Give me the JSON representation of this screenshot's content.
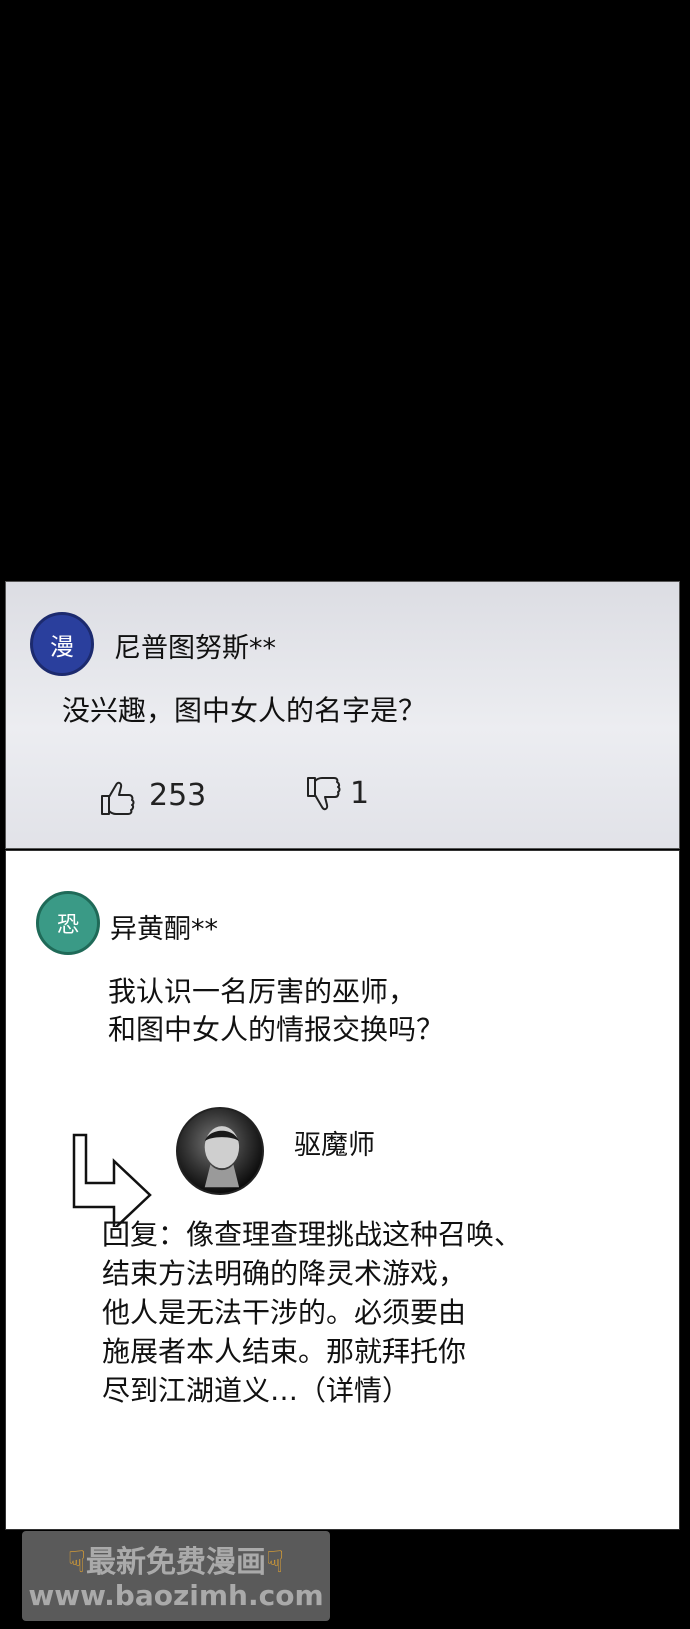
{
  "comment1": {
    "avatar_char": "漫",
    "username": "尼普图努斯**",
    "text": "没兴趣，图中女人的名字是？",
    "likes": "253",
    "dislikes": "1",
    "like_icon": "thumbs-up-icon",
    "dislike_icon": "thumbs-down-icon",
    "avatar_color": "#2a3f9d"
  },
  "comment2": {
    "avatar_char": "恐",
    "username": "异黄酮**",
    "text": "我认识一名厉害的巫师，\n和图中女人的情报交换吗？",
    "avatar_color": "#3a9a86"
  },
  "reply": {
    "arrow_icon": "reply-arrow-icon",
    "username": "驱魔师",
    "text": "回复：像查理查理挑战这种召唤、\n结束方法明确的降灵术游戏，\n他人是无法干涉的。必须要由\n施展者本人结束。那就拜托你\n尽到江湖道义…（详情）"
  },
  "watermark": {
    "line1": "最新免费漫画",
    "line2": "www.baozimh.com"
  }
}
